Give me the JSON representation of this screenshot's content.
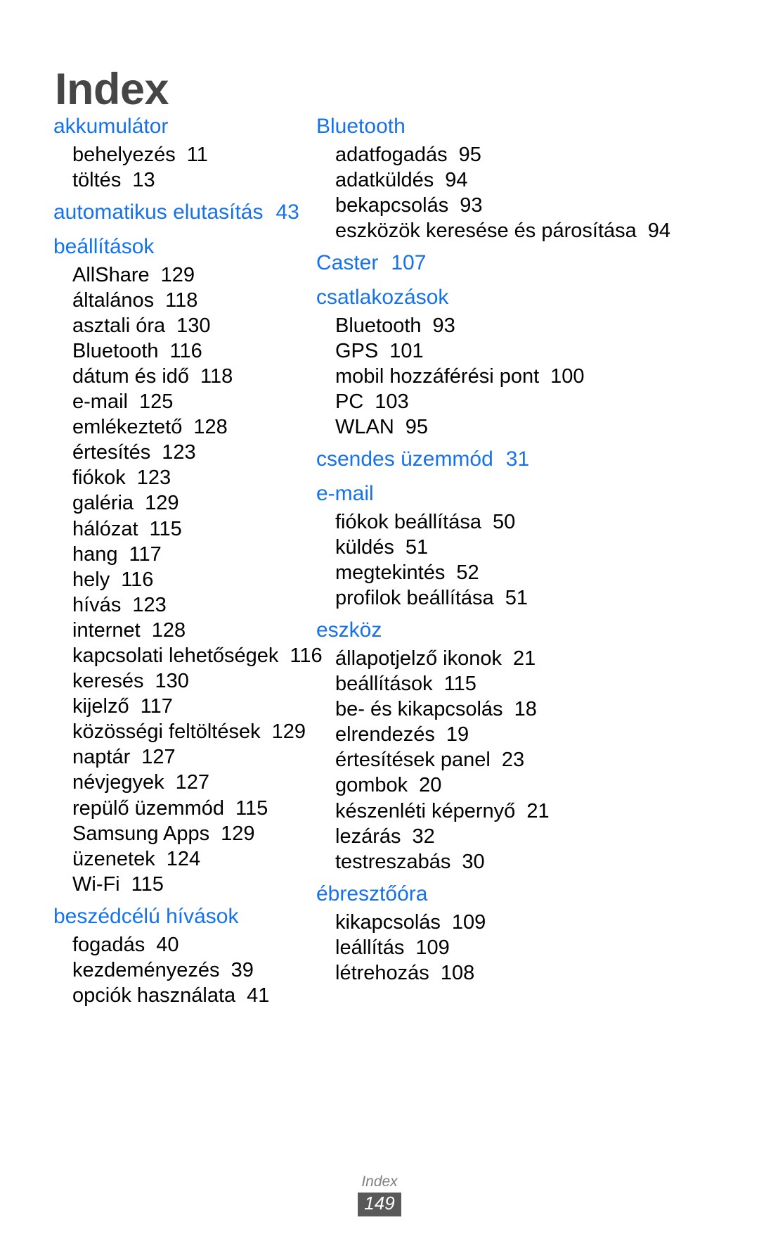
{
  "document": {
    "title": "Index",
    "title_color": "#464646",
    "accent_color": "#1572ea",
    "footer": {
      "label": "Index",
      "page_number": "149"
    }
  },
  "columns": {
    "left": [
      {
        "head": "akkumulátor",
        "head_page": "",
        "items": [
          {
            "label": "behelyezés",
            "page": "11"
          },
          {
            "label": "töltés",
            "page": "13"
          }
        ]
      },
      {
        "head": "automatikus elutasítás",
        "head_page": "43",
        "items": []
      },
      {
        "head": "beállítások",
        "head_page": "",
        "items": [
          {
            "label": "AllShare",
            "page": "129"
          },
          {
            "label": "általános",
            "page": "118"
          },
          {
            "label": "asztali óra",
            "page": "130"
          },
          {
            "label": "Bluetooth",
            "page": "116"
          },
          {
            "label": "dátum és idő",
            "page": "118"
          },
          {
            "label": "e-mail",
            "page": "125"
          },
          {
            "label": "emlékeztető",
            "page": "128"
          },
          {
            "label": "értesítés",
            "page": "123"
          },
          {
            "label": "fiókok",
            "page": "123"
          },
          {
            "label": "galéria",
            "page": "129"
          },
          {
            "label": "hálózat",
            "page": "115"
          },
          {
            "label": "hang",
            "page": "117"
          },
          {
            "label": "hely",
            "page": "116"
          },
          {
            "label": "hívás",
            "page": "123"
          },
          {
            "label": "internet",
            "page": "128"
          },
          {
            "label": "kapcsolati lehetőségek",
            "page": "116"
          },
          {
            "label": "keresés",
            "page": "130"
          },
          {
            "label": "kijelző",
            "page": "117"
          },
          {
            "label": "közösségi feltöltések",
            "page": "129"
          },
          {
            "label": "naptár",
            "page": "127"
          },
          {
            "label": "névjegyek",
            "page": "127"
          },
          {
            "label": "repülő üzemmód",
            "page": "115"
          },
          {
            "label": "Samsung Apps",
            "page": "129"
          },
          {
            "label": "üzenetek",
            "page": "124"
          },
          {
            "label": "Wi-Fi",
            "page": "115"
          }
        ]
      },
      {
        "head": "beszédcélú hívások",
        "head_page": "",
        "items": [
          {
            "label": "fogadás",
            "page": "40"
          },
          {
            "label": "kezdeményezés",
            "page": "39"
          },
          {
            "label": "opciók használata",
            "page": "41"
          }
        ]
      }
    ],
    "right": [
      {
        "head": "Bluetooth",
        "head_page": "",
        "items": [
          {
            "label": "adatfogadás",
            "page": "95"
          },
          {
            "label": "adatküldés",
            "page": "94"
          },
          {
            "label": "bekapcsolás",
            "page": "93"
          },
          {
            "label": "eszközök keresése és párosítása",
            "page": "94"
          }
        ]
      },
      {
        "head": "Caster",
        "head_page": "107",
        "items": []
      },
      {
        "head": "csatlakozások",
        "head_page": "",
        "items": [
          {
            "label": "Bluetooth",
            "page": "93"
          },
          {
            "label": "GPS",
            "page": "101"
          },
          {
            "label": "mobil hozzáférési pont",
            "page": "100"
          },
          {
            "label": "PC",
            "page": "103"
          },
          {
            "label": "WLAN",
            "page": "95"
          }
        ]
      },
      {
        "head": "csendes üzemmód",
        "head_page": "31",
        "items": []
      },
      {
        "head": "e-mail",
        "head_page": "",
        "items": [
          {
            "label": "fiókok beállítása",
            "page": "50"
          },
          {
            "label": "küldés",
            "page": "51"
          },
          {
            "label": "megtekintés",
            "page": "52"
          },
          {
            "label": "profilok beállítása",
            "page": "51"
          }
        ]
      },
      {
        "head": "eszköz",
        "head_page": "",
        "items": [
          {
            "label": "állapotjelző ikonok",
            "page": "21"
          },
          {
            "label": "beállítások",
            "page": "115"
          },
          {
            "label": "be- és kikapcsolás",
            "page": "18"
          },
          {
            "label": "elrendezés",
            "page": "19"
          },
          {
            "label": "értesítések panel",
            "page": "23"
          },
          {
            "label": "gombok",
            "page": "20"
          },
          {
            "label": "készenléti képernyő",
            "page": "21"
          },
          {
            "label": "lezárás",
            "page": "32"
          },
          {
            "label": "testreszabás",
            "page": "30"
          }
        ]
      },
      {
        "head": "ébresztőóra",
        "head_page": "",
        "items": [
          {
            "label": "kikapcsolás",
            "page": "109"
          },
          {
            "label": "leállítás",
            "page": "109"
          },
          {
            "label": "létrehozás",
            "page": "108"
          }
        ]
      }
    ]
  }
}
